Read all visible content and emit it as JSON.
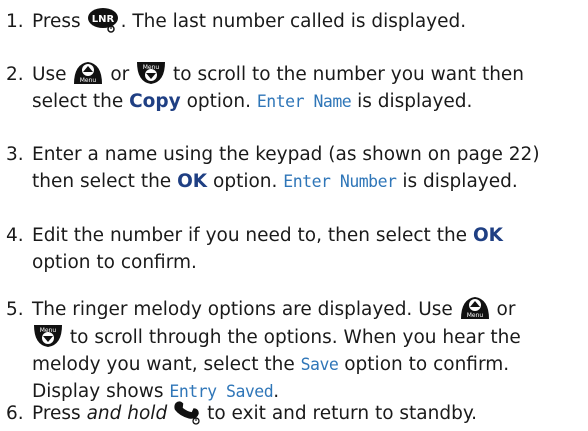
{
  "icons": {
    "lnr": {
      "name": "lnr-key-icon",
      "text": "LNR"
    },
    "up": {
      "name": "scroll-up-menu-key-icon",
      "text": "Menu"
    },
    "down": {
      "name": "scroll-down-menu-key-icon",
      "text": "Menu"
    },
    "end": {
      "name": "end-call-key-icon"
    }
  },
  "steps": [
    {
      "n": "1.",
      "a": "Press ",
      "b": ". The last number called is displayed."
    },
    {
      "n": "2.",
      "a": "Use ",
      "b": " or ",
      "c": " to scroll to the number you want then",
      "d": "select the ",
      "e": "Copy",
      "f": " option. ",
      "g": "Enter Name",
      "h": " is displayed."
    },
    {
      "n": "3.",
      "a": "Enter a name using the keypad (as shown on page 22)",
      "b": "then select the ",
      "c": "OK",
      "d": " option. ",
      "e": "Enter Number",
      "f": " is displayed."
    },
    {
      "n": "4.",
      "a": "Edit the number if you need to, then select the ",
      "b": "OK",
      "c": "option to confirm."
    },
    {
      "n": "5.",
      "a": "The ringer melody options are displayed. Use ",
      "b": " or",
      "c": " to scroll through the options. When you hear the",
      "d": "melody you want, select the ",
      "e": "Save",
      "f": " option to confirm.",
      "g": "Display shows ",
      "h": "Entry Saved",
      "i": "."
    },
    {
      "n": "6.",
      "a": "Press ",
      "b": "and hold",
      "c": " to exit and return to standby."
    }
  ]
}
